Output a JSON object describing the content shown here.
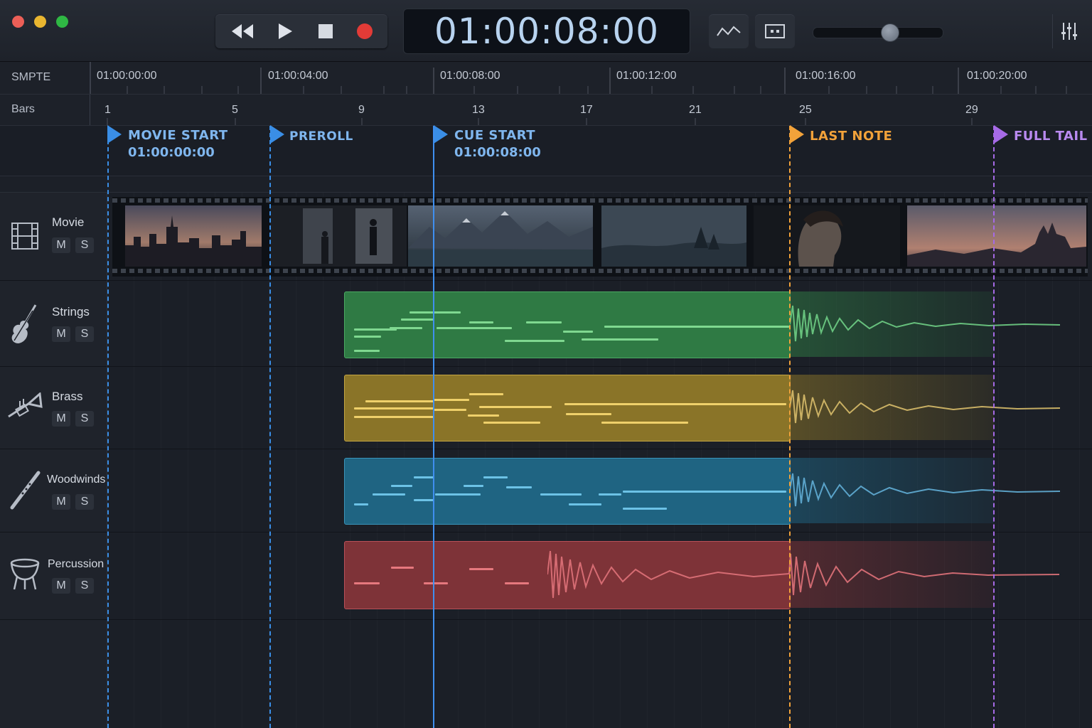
{
  "transport": {
    "timecode": "01:00:08:00",
    "buttons": [
      "rewind",
      "play",
      "stop",
      "record"
    ]
  },
  "colors": {
    "strings": "#3f9a55",
    "brass": "#b79a3a",
    "woodwinds": "#2f86a8",
    "percussion": "#b2494f",
    "marker_blue": "#3a8ee6",
    "marker_orange": "#f2a23a",
    "marker_purple": "#a66ae6",
    "record": "#e23b37"
  },
  "ruler": {
    "smpte_label": "SMPTE",
    "bars_label": "Bars",
    "smpte_ticks": [
      "01:00:00:00",
      "01:00:04:00",
      "01:00:08:00",
      "01:00:12:00",
      "01:00:16:00",
      "01:00:20:00"
    ],
    "bar_ticks": [
      "1",
      "5",
      "9",
      "13",
      "17",
      "21",
      "25",
      "29"
    ]
  },
  "markers": [
    {
      "name": "MOVIE START",
      "time": "01:00:00:00"
    },
    {
      "name": "PREROLL",
      "time": ""
    },
    {
      "name": "CUE START",
      "time": "01:00:08:00"
    },
    {
      "name": "LAST NOTE",
      "time": ""
    },
    {
      "name": "FULL TAIL",
      "time": ""
    }
  ],
  "tracks": [
    {
      "name": "Movie",
      "mute": "M",
      "solo": "S",
      "icon": "film-icon"
    },
    {
      "name": "Strings",
      "mute": "M",
      "solo": "S",
      "icon": "violin-icon"
    },
    {
      "name": "Brass",
      "mute": "M",
      "solo": "S",
      "icon": "trumpet-icon"
    },
    {
      "name": "Woodwinds",
      "mute": "M",
      "solo": "S",
      "icon": "clarinet-icon"
    },
    {
      "name": "Percussion",
      "mute": "M",
      "solo": "S",
      "icon": "timpani-icon"
    }
  ]
}
